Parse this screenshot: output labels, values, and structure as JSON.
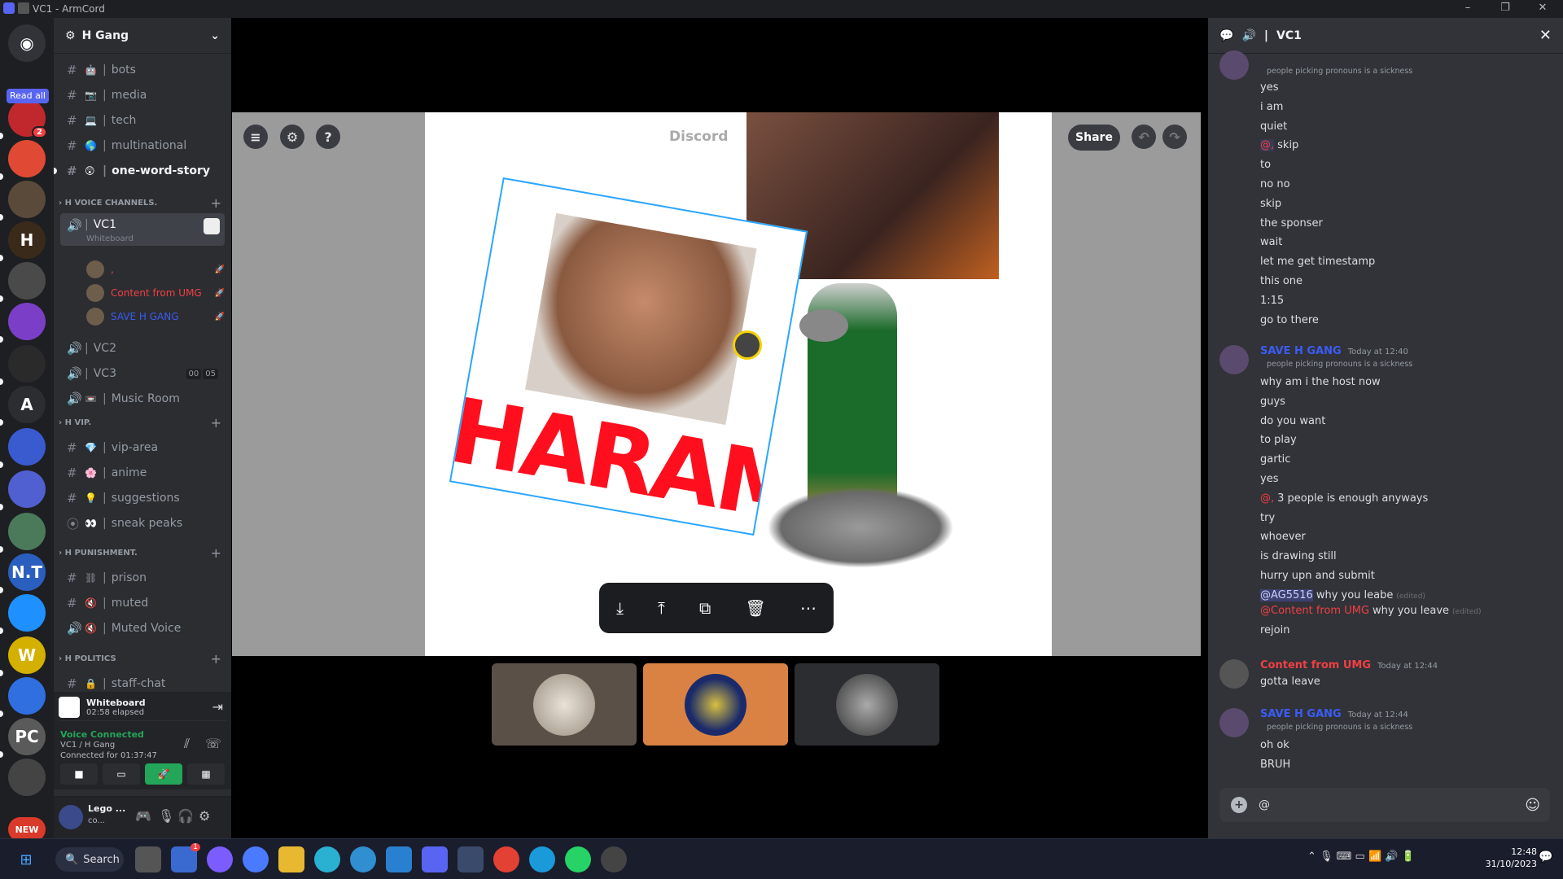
{
  "window": {
    "title": "VC1 - ArmCord"
  },
  "rail": {
    "read_all": "Read all",
    "servers": [
      {
        "id": "dm",
        "label": "",
        "color": "#313338"
      },
      {
        "id": "s1",
        "label": "",
        "color": "#c0282e",
        "badge": "2"
      },
      {
        "id": "s2",
        "label": "",
        "color": "#e04a35"
      },
      {
        "id": "s3",
        "label": "",
        "color": "#5a4a3a"
      },
      {
        "id": "s4",
        "label": "H",
        "color": "#3a2a1a"
      },
      {
        "id": "s5",
        "label": "",
        "color": "#4a4a4a"
      },
      {
        "id": "s6",
        "label": "",
        "color": "#7b3fc7"
      },
      {
        "id": "s7",
        "label": "",
        "color": "#2a2a2a"
      },
      {
        "id": "s8",
        "label": "A",
        "color": "#2b2d31"
      },
      {
        "id": "s9",
        "label": "",
        "color": "#3a5ad0"
      },
      {
        "id": "s10",
        "label": "",
        "color": "#5060d0"
      },
      {
        "id": "s11",
        "label": "",
        "color": "#4a7a5a"
      },
      {
        "id": "s12",
        "label": "N.T",
        "color": "#2a5fbf"
      },
      {
        "id": "s13",
        "label": "",
        "color": "#1e90ff"
      },
      {
        "id": "s14",
        "label": "W",
        "color": "#d4b000"
      },
      {
        "id": "s15",
        "label": "",
        "color": "#2f6fe0"
      },
      {
        "id": "s16",
        "label": "PC",
        "color": "#5a5a5a"
      },
      {
        "id": "s17",
        "label": "",
        "color": "#444"
      },
      {
        "id": "s18",
        "label": "NEW",
        "color": "#d93a2a"
      }
    ]
  },
  "sidebar": {
    "server_name": "H Gang",
    "channels_top": [
      {
        "name": "bots",
        "emoji": "🤖"
      },
      {
        "name": "media",
        "emoji": "📷"
      },
      {
        "name": "tech",
        "emoji": "💻"
      },
      {
        "name": "multinational",
        "emoji": "🌎"
      },
      {
        "name": "one-word-story",
        "emoji": "😲"
      }
    ],
    "cat_voice": "H VOICE CHANNELS.",
    "vc1": "VC1",
    "vc1_sub": "Whiteboard",
    "vc1_users": [
      {
        "name": ",",
        "color": "#f23f43"
      },
      {
        "name": "Content from UMG",
        "color": "#f23f43"
      },
      {
        "name": "SAVE H GANG",
        "color": "#3b5cf5"
      }
    ],
    "vc2": "VC2",
    "vc3": "VC3",
    "vc3_counts": [
      "00",
      "05"
    ],
    "music": "Music Room",
    "cat_vip": "H VIP.",
    "vip": [
      {
        "name": "vip-area",
        "emoji": "💎"
      },
      {
        "name": "anime",
        "emoji": "🌸"
      },
      {
        "name": "suggestions",
        "emoji": "💡"
      },
      {
        "name": "sneak peaks",
        "emoji": "👀"
      }
    ],
    "cat_pun": "H PUNISHMENT.",
    "pun": [
      {
        "name": "prison",
        "emoji": "⛓"
      },
      {
        "name": "muted",
        "emoji": "🔇"
      },
      {
        "name": "Muted Voice",
        "emoji": "🔇"
      }
    ],
    "cat_pol": "H POLITICS",
    "pol": [
      {
        "name": "staff-chat",
        "emoji": "🔒"
      }
    ]
  },
  "activity": {
    "name": "Whiteboard",
    "elapsed": "02:58 elapsed"
  },
  "voice": {
    "status": "Voice Connected",
    "channel": "VC1 / H Gang",
    "connected": "Connected for 01:37:47"
  },
  "user": {
    "name": "Lego ...",
    "status": "co..."
  },
  "whiteboard": {
    "watermark": "Discord",
    "haram_text": "HARAM",
    "share": "Share"
  },
  "chat": {
    "channel": "VC1",
    "top_tag": "people picking pronouns is a sickness",
    "group1": [
      "yes",
      "i am",
      "quiet",
      "skip",
      "to",
      "no no",
      "skip",
      "the sponser",
      "wait",
      "let me get timestamp",
      "this one",
      "1:15",
      "go to there"
    ],
    "skip_mention": "@,",
    "g2_name": "SAVE H GANG",
    "g2_time": "Today at 12:40",
    "g2_tag": "people picking pronouns is a sickness",
    "group2": [
      "why am i the host now",
      "guys",
      "do you want",
      "to play",
      "gartic",
      "yes"
    ],
    "g2_mention_prefix": "@,",
    "g2_mention_text": "3 people is enough anyways",
    "group2b": [
      "try",
      "whoever",
      "is drawing still",
      "hurry upn and submit"
    ],
    "reply1_mention": "@AG5516",
    "reply1_text": "why you leabe",
    "edited": "(edited)",
    "reply2_mention": "@Content from UMG",
    "reply2_text": "why you leave",
    "rejoin": "rejoin",
    "g3_name": "Content from UMG",
    "g3_time": "Today at 12:44",
    "g3_text": "gotta leave",
    "g4_name": "SAVE H GANG",
    "g4_time": "Today at 12:44",
    "g4_tag": "people picking pronouns is a sickness",
    "group4": [
      "oh ok",
      "BRUH"
    ],
    "input_value": "@"
  },
  "taskbar": {
    "search": "Search",
    "time": "12:48",
    "date": "31/10/2023",
    "badge": "1"
  }
}
